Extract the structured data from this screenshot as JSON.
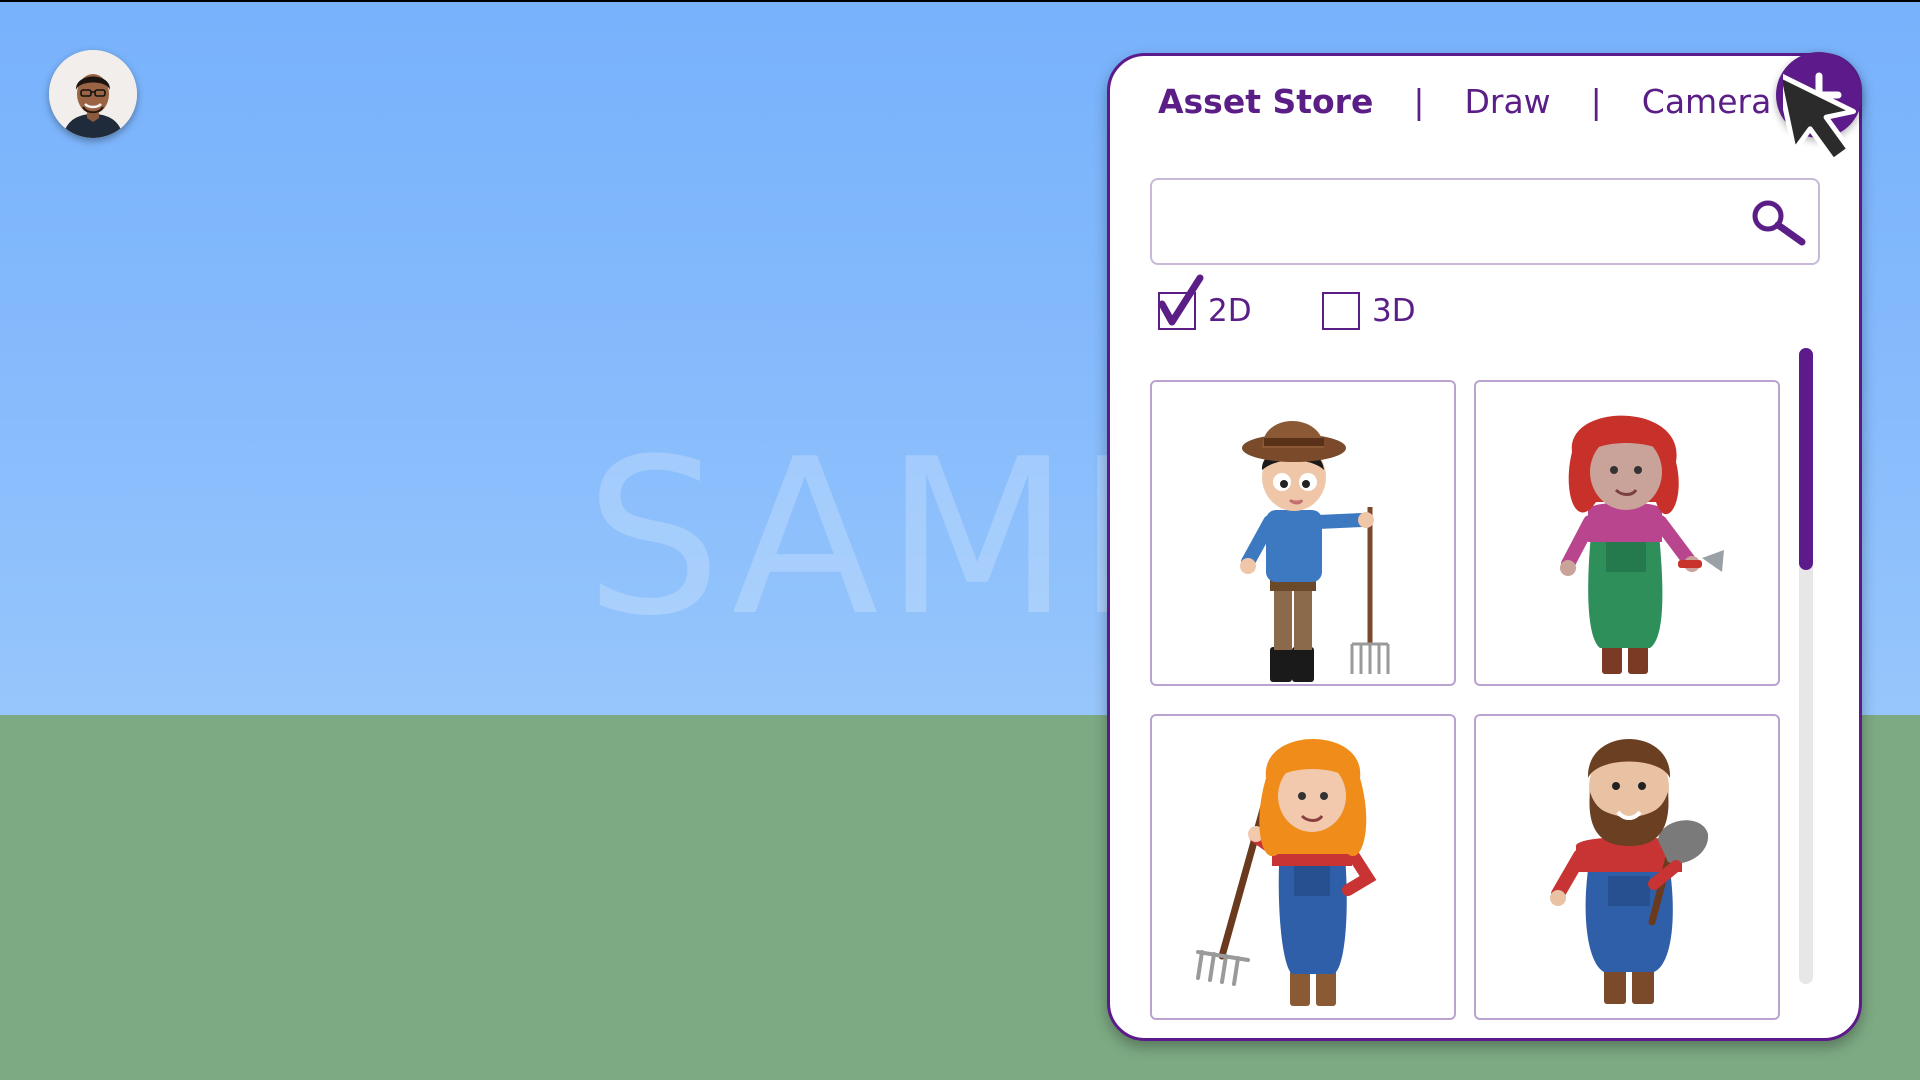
{
  "watermark": "SAMPLE",
  "panel": {
    "tabs": [
      {
        "label": "Asset Store",
        "active": true
      },
      {
        "label": "|"
      },
      {
        "label": "Draw",
        "active": false
      },
      {
        "label": "|"
      },
      {
        "label": "Camera",
        "active": false
      }
    ],
    "search": {
      "value": "",
      "placeholder": ""
    },
    "filters": [
      {
        "label": "2D",
        "checked": true
      },
      {
        "label": "3D",
        "checked": false
      }
    ],
    "assets": [
      {
        "icon": "farmer-boy-with-pitchfork-icon"
      },
      {
        "icon": "red-haired-farmer-with-trowel-icon"
      },
      {
        "icon": "orange-haired-farmer-with-rake-icon"
      },
      {
        "icon": "bearded-farmer-with-shovel-icon"
      }
    ],
    "scroll_position": 0.0
  },
  "colors": {
    "accent": "#5c1a8a",
    "sky": "#86bbfc",
    "ground": "#7daa83"
  }
}
